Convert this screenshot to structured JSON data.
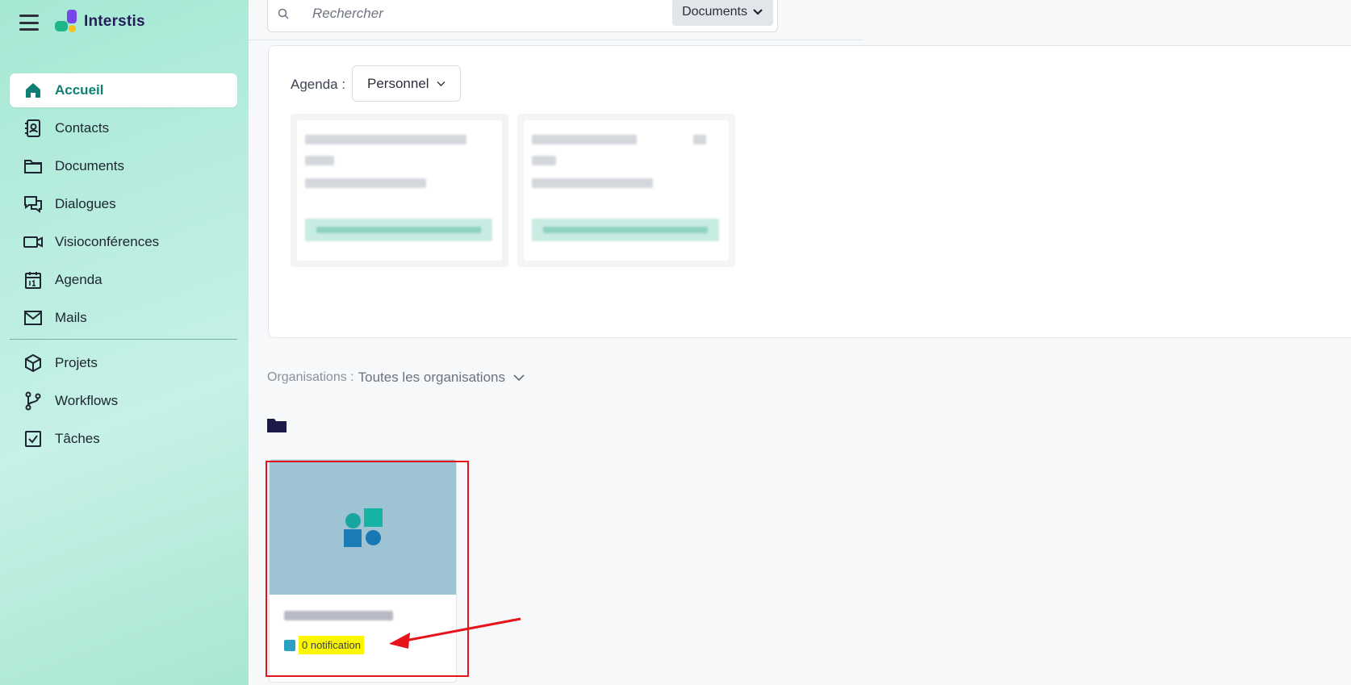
{
  "app": {
    "name": "Interstis"
  },
  "sidebar": {
    "items": [
      {
        "label": "Accueil",
        "icon": "home-icon",
        "active": true
      },
      {
        "label": "Contacts",
        "icon": "contacts-book-icon"
      },
      {
        "label": "Documents",
        "icon": "folder-icon"
      },
      {
        "label": "Dialogues",
        "icon": "chat-bubbles-icon"
      },
      {
        "label": "Visioconférences",
        "icon": "video-camera-icon"
      },
      {
        "label": "Agenda",
        "icon": "calendar-icon"
      },
      {
        "label": "Mails",
        "icon": "envelope-icon"
      },
      {
        "label": "Projets",
        "icon": "cube-icon"
      },
      {
        "label": "Workflows",
        "icon": "git-branch-icon"
      },
      {
        "label": "Tâches",
        "icon": "checkbox-icon"
      }
    ]
  },
  "search": {
    "placeholder": "Rechercher",
    "scope": "Documents"
  },
  "agenda": {
    "label": "Agenda :",
    "selected": "Personnel"
  },
  "organisations": {
    "label": "Organisations :",
    "selected": "Toutes les organisations"
  },
  "workspace_card": {
    "notification": "0 notification"
  },
  "colors": {
    "accent": "#0f7e73",
    "highlight": "#fbf700",
    "annotation": "#e6131a"
  }
}
